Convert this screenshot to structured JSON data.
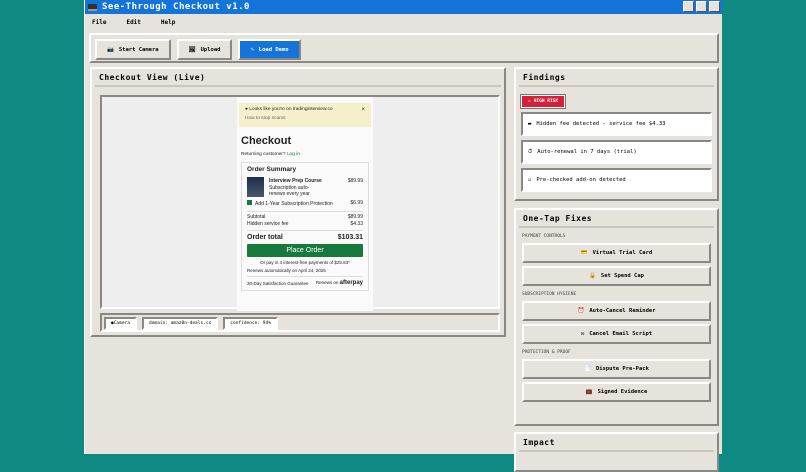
{
  "app": {
    "title": "See-Through Checkout v1.0",
    "menu": [
      "File",
      "Edit",
      "Help"
    ]
  },
  "toolbar": {
    "start_camera": "Start Camera",
    "upload": "Upload",
    "load_demo": "Load Demo"
  },
  "left_panel": {
    "title": "Checkout View (Live)"
  },
  "checkout": {
    "banner_text": "Looks like you're on tradinginterview.co",
    "banner_link": "How to stop scams",
    "banner_close": "×",
    "heading": "Checkout",
    "returning": "Returning customer?",
    "login": "Log in",
    "summary_title": "Order Summary",
    "item_name": "Interview Prep Course",
    "item_price": "$89.99",
    "item_desc": "Subscription auto-renews every year",
    "addon_label": "Add 1-Year Subscription Protection",
    "addon_price": "$6.99",
    "subtotal_label": "Subtotal",
    "subtotal": "$89.99",
    "fee_label": "Hidden service fee",
    "fee": "$4.33",
    "total_label": "Order total",
    "total": "$103.31",
    "place_order": "Place Order",
    "installments": "Or pay in 4 interest-free payments of $25.83*",
    "renews": "Renews automatically on April 24, 2025",
    "guarantee": "30-Day Satisfaction Guarantee",
    "powered": "Renews on",
    "afterpay": "afterpay"
  },
  "status": {
    "camera": "Camera",
    "domain": "domain: amaz0n-deals.cc",
    "confidence": "confidence: 94%"
  },
  "findings": {
    "title": "Findings",
    "risk": "HIGH RISK",
    "items": [
      "Hidden fee detected - service fee $4.33",
      "Auto-renewal in 7 days (trial)",
      "Pre-checked add-on detected"
    ]
  },
  "fixes": {
    "title": "One-Tap Fixes",
    "sections": [
      {
        "label": "PAYMENT CONTROLS",
        "buttons": [
          "Virtual Trial Card",
          "Set Spend Cap"
        ]
      },
      {
        "label": "SUBSCRIPTION HYGIENE",
        "buttons": [
          "Auto-Cancel Reminder",
          "Cancel Email Script"
        ]
      },
      {
        "label": "PROTECTION & PROOF",
        "buttons": [
          "Dispute Pre-Pack",
          "Signed Evidence"
        ]
      }
    ]
  },
  "impact": {
    "title": "Impact"
  },
  "colors": {
    "titlebar": "#1474d8",
    "danger": "#d6203a",
    "brand_green": "#157a3c",
    "desktop": "#0f8a82"
  }
}
